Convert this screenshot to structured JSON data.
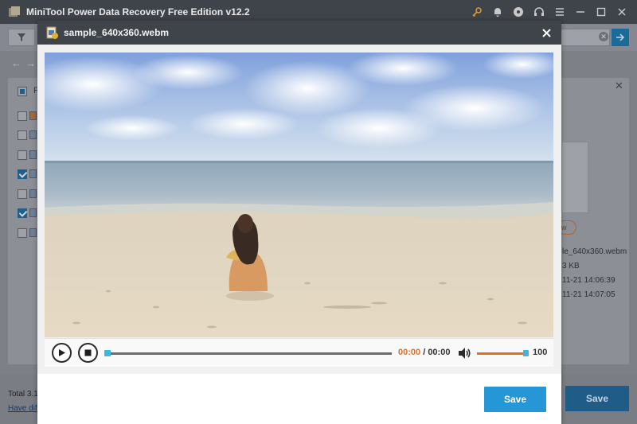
{
  "app": {
    "title": "MiniTool Power Data Recovery Free Edition v12.2",
    "title_icons": [
      "key-icon",
      "bell-icon",
      "disc-icon",
      "headset-icon",
      "menu-icon",
      "minimize-icon",
      "maximize-icon",
      "close-icon"
    ],
    "list_header_first_letter": "F",
    "rows": [
      {
        "checked": false
      },
      {
        "checked": false
      },
      {
        "checked": false
      },
      {
        "checked": true
      },
      {
        "checked": false
      },
      {
        "checked": true
      },
      {
        "checked": false
      }
    ],
    "details": {
      "preview_label": "w",
      "file_name": "le_640x360.webm",
      "size": "3 KB",
      "created": "11-21 14:06:39",
      "modified": "11-21 14:07:05"
    },
    "status": {
      "total": "Total 3.1",
      "link": "Have diff"
    },
    "save_label": "Save"
  },
  "modal": {
    "title": "sample_640x360.webm",
    "player": {
      "current_time": "00:00",
      "separator": " / ",
      "total_time": "00:00",
      "progress": 0,
      "volume": 100,
      "volume_label": "100"
    },
    "save_label": "Save"
  },
  "colors": {
    "accent": "#2596d6",
    "time_highlight": "#e07020",
    "title_bar": "#3f434a"
  }
}
